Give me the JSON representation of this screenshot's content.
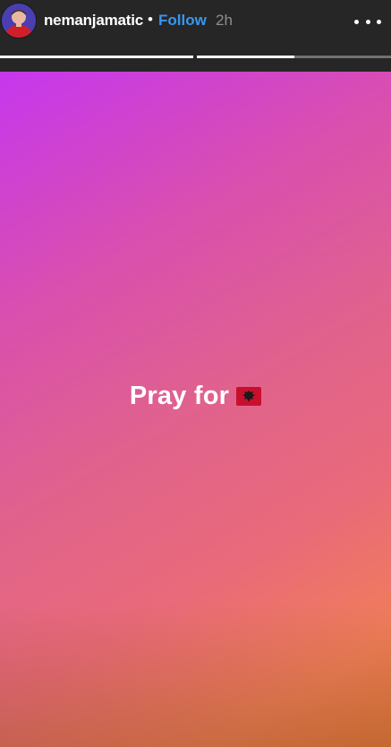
{
  "header": {
    "username": "nemanjamatic",
    "separator": "•",
    "follow_label": "Follow",
    "time_ago": "2h",
    "more_icon": "more-horizontal-icon"
  },
  "progress": {
    "segments": [
      {
        "progress": 1.0
      },
      {
        "progress": 0.5
      }
    ]
  },
  "story": {
    "caption_text": "Pray for",
    "caption_emoji": "albania-flag-icon"
  },
  "colors": {
    "follow": "#3897f0",
    "header_bg": "#262626",
    "gradient_start": "#c637ee",
    "gradient_end": "#e77b3d"
  }
}
